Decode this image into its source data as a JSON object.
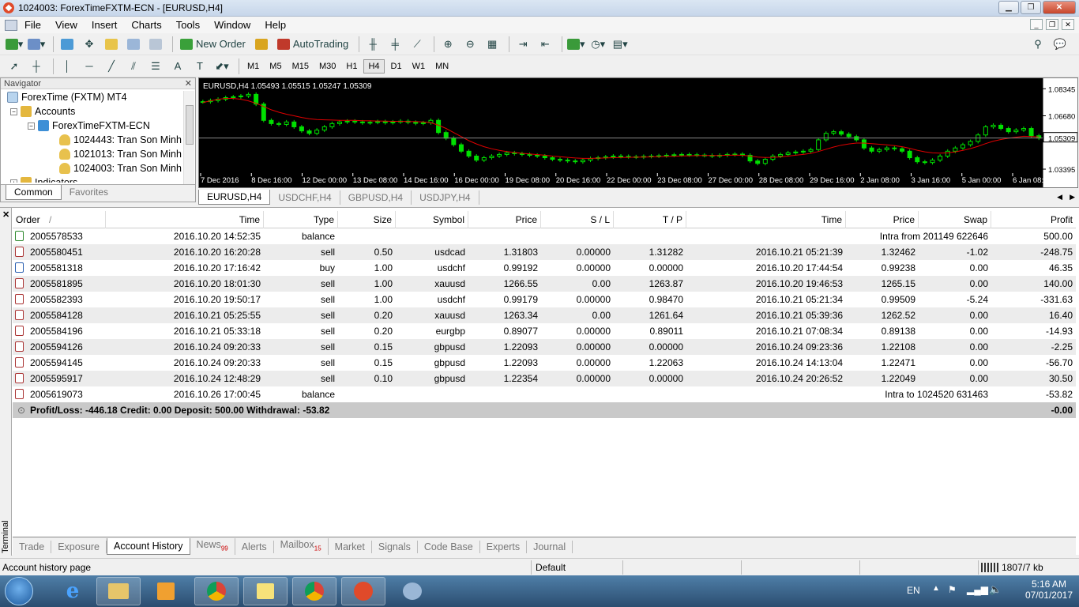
{
  "window": {
    "title": "1024003: ForexTimeFXTM-ECN - [EURUSD,H4]"
  },
  "menu": [
    "File",
    "View",
    "Insert",
    "Charts",
    "Tools",
    "Window",
    "Help"
  ],
  "toolbar": {
    "new_order": "New Order",
    "autotrading": "AutoTrading"
  },
  "timeframes": [
    "M1",
    "M5",
    "M15",
    "M30",
    "H1",
    "H4",
    "D1",
    "W1",
    "MN"
  ],
  "active_timeframe": "H4",
  "navigator": {
    "title": "Navigator",
    "root": "ForexTime (FXTM) MT4",
    "accounts_label": "Accounts",
    "server": "ForexTimeFXTM-ECN",
    "accounts": [
      "1024443: Tran Son Minh",
      "1021013: Tran Son Minh",
      "1024003: Tran Son Minh"
    ],
    "indicators_label": "Indicators",
    "tabs": [
      "Common",
      "Favorites"
    ]
  },
  "chart_data": {
    "type": "candlestick",
    "header": "EURUSD,H4  1.05493 1.05515 1.05247 1.05309",
    "x_labels": [
      "7 Dec 2016",
      "8 Dec 16:00",
      "12 Dec 00:00",
      "13 Dec 08:00",
      "14 Dec 16:00",
      "16 Dec 00:00",
      "19 Dec 08:00",
      "20 Dec 16:00",
      "22 Dec 00:00",
      "23 Dec 08:00",
      "27 Dec 00:00",
      "28 Dec 08:00",
      "29 Dec 16:00",
      "2 Jan 08:00",
      "3 Jan 16:00",
      "5 Jan 00:00",
      "6 Jan 08:00"
    ],
    "y_labels": [
      "1.08345",
      "1.06680",
      "1.05309",
      "1.03395"
    ],
    "current_price": "1.05309",
    "ylim": [
      1.0325,
      1.087
    ],
    "closes": [
      1.0755,
      1.0762,
      1.077,
      1.078,
      1.0785,
      1.079,
      1.08,
      1.074,
      1.064,
      1.062,
      1.0615,
      1.063,
      1.06,
      1.0575,
      1.056,
      1.058,
      1.06,
      1.062,
      1.063,
      1.0635,
      1.063,
      1.0625,
      1.0628,
      1.0632,
      1.0626,
      1.063,
      1.0635,
      1.0628,
      1.0622,
      1.0625,
      1.064,
      1.0565,
      1.053,
      1.049,
      1.045,
      1.042,
      1.0395,
      1.041,
      1.042,
      1.043,
      1.044,
      1.0435,
      1.043,
      1.0425,
      1.042,
      1.041,
      1.04,
      1.0395,
      1.039,
      1.0385,
      1.0395,
      1.0405,
      1.041,
      1.0415,
      1.042,
      1.0418,
      1.0416,
      1.0414,
      1.0418,
      1.042,
      1.0422,
      1.0425,
      1.0428,
      1.043,
      1.0428,
      1.0426,
      1.0424,
      1.042,
      1.0425,
      1.043,
      1.0432,
      1.0425,
      1.039,
      1.0375,
      1.04,
      1.042,
      1.043,
      1.044,
      1.0445,
      1.045,
      1.046,
      1.052,
      1.056,
      1.057,
      1.0555,
      1.054,
      1.052,
      1.047,
      1.045,
      1.046,
      1.047,
      1.0465,
      1.045,
      1.041,
      1.0385,
      1.038,
      1.0395,
      1.042,
      1.045,
      1.047,
      1.049,
      1.051,
      1.055,
      1.06,
      1.061,
      1.059,
      1.057,
      1.058,
      1.059,
      1.0545,
      1.0531
    ],
    "ma": [
      1.075,
      1.076,
      1.077,
      1.0775,
      1.0775,
      1.077,
      1.076,
      1.0745,
      1.0725,
      1.0705,
      1.069,
      1.0678,
      1.0668,
      1.0658,
      1.065,
      1.0645,
      1.0643,
      1.0642,
      1.064,
      1.064,
      1.064,
      1.0638,
      1.0637,
      1.0636,
      1.0635,
      1.0634,
      1.0634,
      1.0633,
      1.0632,
      1.063,
      1.0625,
      1.061,
      1.059,
      1.0565,
      1.054,
      1.0515,
      1.0495,
      1.0478,
      1.0465,
      1.0455,
      1.0448,
      1.0442,
      1.0437,
      1.0433,
      1.0429,
      1.0425,
      1.042,
      1.0416,
      1.0412,
      1.0408,
      1.0406,
      1.0406,
      1.0407,
      1.0408,
      1.041,
      1.0411,
      1.0412,
      1.0413,
      1.0414,
      1.0415,
      1.0416,
      1.0418,
      1.0419,
      1.0421,
      1.0422,
      1.0423,
      1.0424,
      1.0424,
      1.0424,
      1.0425,
      1.0426,
      1.0425,
      1.042,
      1.0414,
      1.0411,
      1.0412,
      1.0415,
      1.042,
      1.0425,
      1.043,
      1.0437,
      1.0448,
      1.0462,
      1.0476,
      1.0487,
      1.0495,
      1.05,
      1.05,
      1.0497,
      1.0493,
      1.0489,
      1.0484,
      1.0478,
      1.0468,
      1.0456,
      1.0446,
      1.044,
      1.0438,
      1.044,
      1.0446,
      1.0455,
      1.0466,
      1.048,
      1.0497,
      1.0512,
      1.0522,
      1.053,
      1.0536,
      1.0542,
      1.054,
      1.0538
    ]
  },
  "chart_tabs": [
    "EURUSD,H4",
    "USDCHF,H4",
    "GBPUSD,H4",
    "USDJPY,H4"
  ],
  "table": {
    "headers": {
      "order": "Order",
      "sort": "/",
      "time": "Time",
      "type": "Type",
      "size": "Size",
      "symbol": "Symbol",
      "price": "Price",
      "sl": "S / L",
      "tp": "T / P",
      "time2": "Time",
      "price2": "Price",
      "swap": "Swap",
      "profit": "Profit"
    },
    "rows": [
      {
        "icon": "green",
        "order": "2005578533",
        "time": "2016.10.20 14:52:35",
        "type": "balance",
        "comment": "Intra from 201149 622646",
        "profit": "500.00"
      },
      {
        "icon": "red",
        "order": "2005580451",
        "time": "2016.10.20 16:20:28",
        "type": "sell",
        "size": "0.50",
        "symbol": "usdcad",
        "price": "1.31803",
        "sl": "0.00000",
        "tp": "1.31282",
        "time2": "2016.10.21 05:21:39",
        "price2": "1.32462",
        "swap": "-1.02",
        "profit": "-248.75"
      },
      {
        "icon": "blue",
        "order": "2005581318",
        "time": "2016.10.20 17:16:42",
        "type": "buy",
        "size": "1.00",
        "symbol": "usdchf",
        "price": "0.99192",
        "sl": "0.00000",
        "tp": "0.00000",
        "time2": "2016.10.20 17:44:54",
        "price2": "0.99238",
        "swap": "0.00",
        "profit": "46.35"
      },
      {
        "icon": "red",
        "order": "2005581895",
        "time": "2016.10.20 18:01:30",
        "type": "sell",
        "size": "1.00",
        "symbol": "xauusd",
        "price": "1266.55",
        "sl": "0.00",
        "tp": "1263.87",
        "time2": "2016.10.20 19:46:53",
        "price2": "1265.15",
        "swap": "0.00",
        "profit": "140.00"
      },
      {
        "icon": "red",
        "order": "2005582393",
        "time": "2016.10.20 19:50:17",
        "type": "sell",
        "size": "1.00",
        "symbol": "usdchf",
        "price": "0.99179",
        "sl": "0.00000",
        "tp": "0.98470",
        "time2": "2016.10.21 05:21:34",
        "price2": "0.99509",
        "swap": "-5.24",
        "profit": "-331.63"
      },
      {
        "icon": "red",
        "order": "2005584128",
        "time": "2016.10.21 05:25:55",
        "type": "sell",
        "size": "0.20",
        "symbol": "xauusd",
        "price": "1263.34",
        "sl": "0.00",
        "tp": "1261.64",
        "time2": "2016.10.21 05:39:36",
        "price2": "1262.52",
        "swap": "0.00",
        "profit": "16.40"
      },
      {
        "icon": "red",
        "order": "2005584196",
        "time": "2016.10.21 05:33:18",
        "type": "sell",
        "size": "0.20",
        "symbol": "eurgbp",
        "price": "0.89077",
        "sl": "0.00000",
        "tp": "0.89011",
        "time2": "2016.10.21 07:08:34",
        "price2": "0.89138",
        "swap": "0.00",
        "profit": "-14.93"
      },
      {
        "icon": "red",
        "order": "2005594126",
        "time": "2016.10.24 09:20:33",
        "type": "sell",
        "size": "0.15",
        "symbol": "gbpusd",
        "price": "1.22093",
        "sl": "0.00000",
        "tp": "0.00000",
        "time2": "2016.10.24 09:23:36",
        "price2": "1.22108",
        "swap": "0.00",
        "profit": "-2.25"
      },
      {
        "icon": "red",
        "order": "2005594145",
        "time": "2016.10.24 09:20:33",
        "type": "sell",
        "size": "0.15",
        "symbol": "gbpusd",
        "price": "1.22093",
        "sl": "0.00000",
        "tp": "1.22063",
        "time2": "2016.10.24 14:13:04",
        "price2": "1.22471",
        "swap": "0.00",
        "profit": "-56.70"
      },
      {
        "icon": "red",
        "order": "2005595917",
        "time": "2016.10.24 12:48:29",
        "type": "sell",
        "size": "0.10",
        "symbol": "gbpusd",
        "price": "1.22354",
        "sl": "0.00000",
        "tp": "0.00000",
        "time2": "2016.10.24 20:26:52",
        "price2": "1.22049",
        "swap": "0.00",
        "profit": "30.50"
      },
      {
        "icon": "red",
        "order": "2005619073",
        "time": "2016.10.26 17:00:45",
        "type": "balance",
        "comment": "Intra to 1024520 631463",
        "profit": "-53.82"
      }
    ],
    "summary": {
      "text": "Profit/Loss: -446.18  Credit: 0.00  Deposit: 500.00  Withdrawal: -53.82",
      "profit": "-0.00"
    }
  },
  "terminal": {
    "label": "Terminal"
  },
  "terminal_tabs": [
    {
      "label": "Trade"
    },
    {
      "label": "Exposure"
    },
    {
      "label": "Account History",
      "active": true
    },
    {
      "label": "News",
      "badge": "99"
    },
    {
      "label": "Alerts"
    },
    {
      "label": "Mailbox",
      "badge": "15"
    },
    {
      "label": "Market"
    },
    {
      "label": "Signals"
    },
    {
      "label": "Code Base"
    },
    {
      "label": "Experts"
    },
    {
      "label": "Journal"
    }
  ],
  "status": {
    "left": "Account history page",
    "profile": "Default",
    "traffic": "1807/7 kb"
  },
  "taskbar": {
    "lang": "EN",
    "time": "5:16 AM",
    "date": "07/01/2017"
  },
  "colors": {
    "bullish": "#00e000",
    "ma_line": "#e00000",
    "chart_bg": "#000000"
  }
}
